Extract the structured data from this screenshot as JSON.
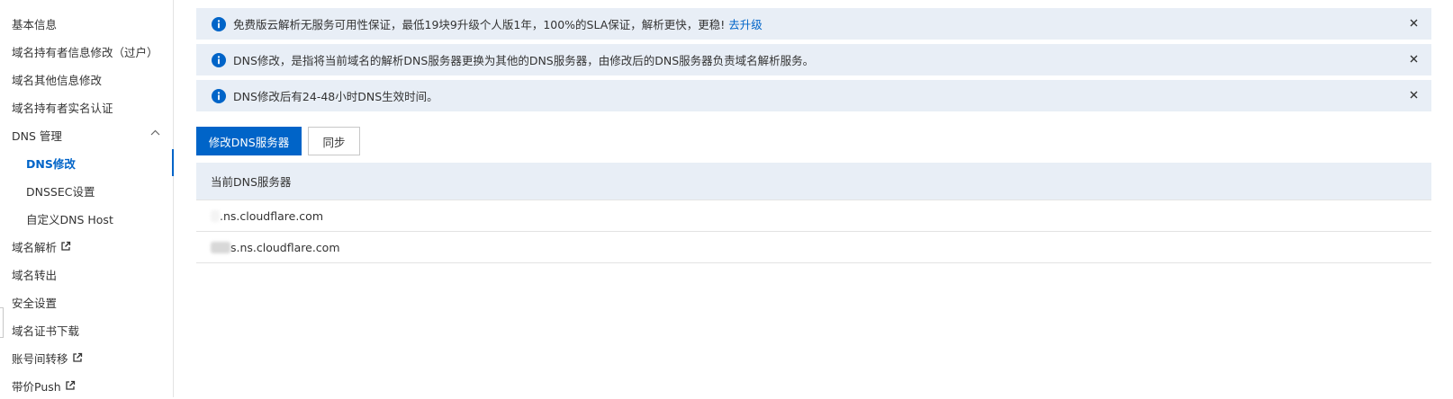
{
  "sidebar": {
    "items": [
      {
        "label": "基本信息"
      },
      {
        "label": "域名持有者信息修改（过户）"
      },
      {
        "label": "域名其他信息修改"
      },
      {
        "label": "域名持有者实名认证"
      },
      {
        "label": "DNS 管理",
        "expanded": true,
        "icon": "chevron-up-icon"
      },
      {
        "label": "DNS修改",
        "active": true
      },
      {
        "label": "DNSSEC设置"
      },
      {
        "label": "自定义DNS Host"
      },
      {
        "label": "域名解析",
        "icon": "external-link-icon"
      },
      {
        "label": "域名转出"
      },
      {
        "label": "安全设置"
      },
      {
        "label": "域名证书下载"
      },
      {
        "label": "账号间转移",
        "icon": "external-link-icon"
      },
      {
        "label": "带价Push",
        "icon": "external-link-icon"
      }
    ]
  },
  "notices": [
    {
      "text": "免费版云解析无服务可用性保证，最低19块9升级个人版1年，100%的SLA保证，解析更快，更稳!",
      "link": "去升级"
    },
    {
      "text": "DNS修改，是指将当前域名的解析DNS服务器更换为其他的DNS服务器，由修改后的DNS服务器负责域名解析服务。"
    },
    {
      "text": "DNS修改后有24-48小时DNS生效时间。"
    }
  ],
  "actions": {
    "modify_label": "修改DNS服务器",
    "sync_label": "同步"
  },
  "table": {
    "header": "当前DNS服务器",
    "rows": [
      {
        "value": ".ns.cloudflare.com"
      },
      {
        "value": "s.ns.cloudflare.com"
      }
    ]
  },
  "colors": {
    "accent": "#0064c8",
    "notice_bg": "#e8eef6"
  }
}
